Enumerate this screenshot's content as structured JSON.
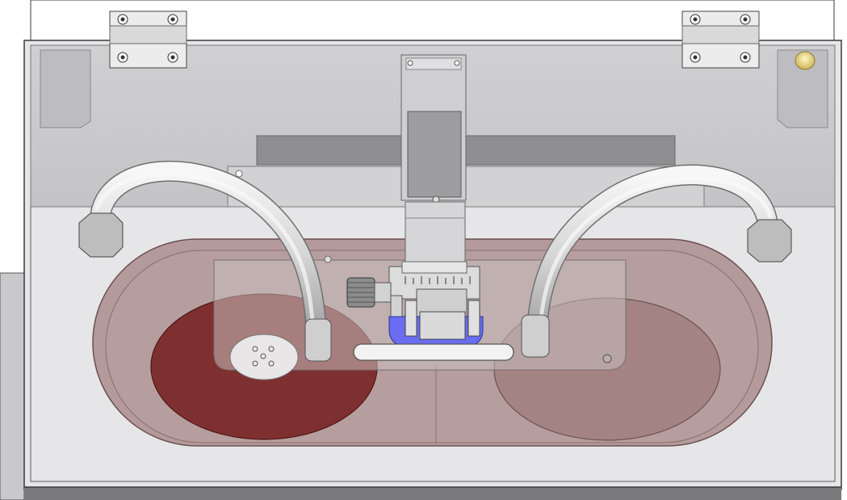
{
  "scene": {
    "type": "cad-render",
    "subject": "grinding-polishing-machine-top-view",
    "colors": {
      "background": "#ffffff",
      "housing_outline": "#3a3a3a",
      "lid_tint": "#c9c9cc",
      "lower_panel": "#e3e3e5",
      "bowl_interior": "#b79c9c",
      "left_disc": "#7e3030",
      "right_disc": "#a58484",
      "specimen_holder": "#6a6cf2",
      "hose": "#dedede",
      "hinge": "#ececec",
      "indicator": "#d9c368"
    },
    "components": [
      "hinge-left",
      "hinge-right",
      "motor-column",
      "pressure-head",
      "micrometer-knob",
      "hose-left",
      "hose-right",
      "polishing-disc-left",
      "polishing-disc-right",
      "sample-holder",
      "handle-bar",
      "indicator-light"
    ]
  }
}
